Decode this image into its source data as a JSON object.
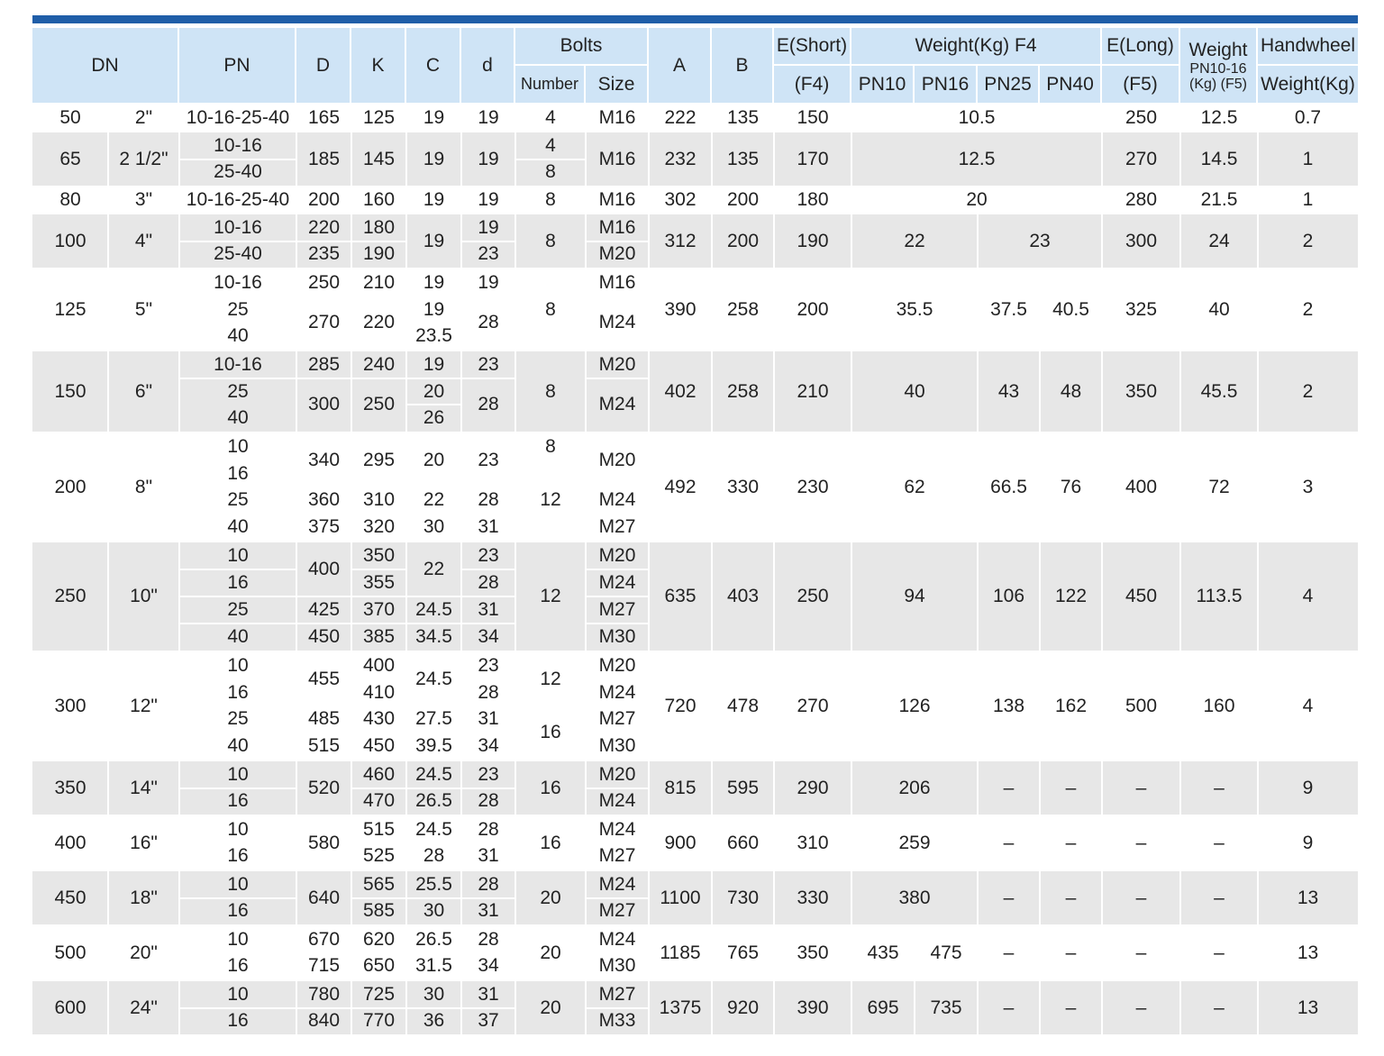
{
  "headers": {
    "dn": "DN",
    "pn": "PN",
    "d_upper": "D",
    "k": "K",
    "c": "C",
    "d_lower": "d",
    "bolts": "Bolts",
    "bolts_number": "Number",
    "bolts_size": "Size",
    "a": "A",
    "b": "B",
    "e_short": "E(Short)",
    "e_short_sub": "(F4)",
    "weight_f4": "Weight(Kg) F4",
    "pn10": "PN10",
    "pn16": "PN16",
    "pn25": "PN25",
    "pn40": "PN40",
    "e_long": "E(Long)",
    "e_long_sub": "(F5)",
    "weight_f5": "Weight",
    "weight_f5_sub1": "PN10-16",
    "weight_f5_sub2": "(Kg) (F5)",
    "handwheel": "Handwheel",
    "handwheel_sub": "Weight(Kg)"
  },
  "colors": {
    "header_bg": "#cfe4f6",
    "row_shade": "#e7e7e7",
    "top_bar": "#1f5ea8",
    "grid_line": "#ffffff"
  },
  "rows": [
    {
      "dn": "50",
      "inch": "2\"",
      "pn": [
        "10-16-25-40"
      ],
      "D": [
        "165"
      ],
      "K": [
        "125"
      ],
      "C": [
        "19"
      ],
      "d": [
        "19"
      ],
      "bolt_number": [
        "4"
      ],
      "bolt_size": [
        "M16"
      ],
      "A": "222",
      "B": "135",
      "E_short": "150",
      "w_pn10": "10.5",
      "w_pn16": "",
      "w_pn25": "",
      "w_pn40": "",
      "E_long": "250",
      "weight_f5": "12.5",
      "handwheel": "0.7"
    },
    {
      "dn": "65",
      "inch": "2 1/2\"",
      "pn": [
        "10-16",
        "25-40"
      ],
      "D": [
        "185"
      ],
      "K": [
        "145"
      ],
      "C": [
        "19"
      ],
      "d": [
        "19"
      ],
      "bolt_number": [
        "4",
        "8"
      ],
      "bolt_size": [
        "M16"
      ],
      "A": "232",
      "B": "135",
      "E_short": "170",
      "w_pn10": "12.5",
      "w_pn16": "",
      "w_pn25": "",
      "w_pn40": "",
      "E_long": "270",
      "weight_f5": "14.5",
      "handwheel": "1"
    },
    {
      "dn": "80",
      "inch": "3\"",
      "pn": [
        "10-16-25-40"
      ],
      "D": [
        "200"
      ],
      "K": [
        "160"
      ],
      "C": [
        "19"
      ],
      "d": [
        "19"
      ],
      "bolt_number": [
        "8"
      ],
      "bolt_size": [
        "M16"
      ],
      "A": "302",
      "B": "200",
      "E_short": "180",
      "w_pn10": "20",
      "w_pn16": "",
      "w_pn25": "",
      "w_pn40": "",
      "E_long": "280",
      "weight_f5": "21.5",
      "handwheel": "1"
    },
    {
      "dn": "100",
      "inch": "4\"",
      "pn": [
        "10-16",
        "25-40"
      ],
      "D": [
        "220",
        "235"
      ],
      "K": [
        "180",
        "190"
      ],
      "C": [
        "19"
      ],
      "d": [
        "19",
        "23"
      ],
      "bolt_number": [
        "8"
      ],
      "bolt_size": [
        "M16",
        "M20"
      ],
      "A": "312",
      "B": "200",
      "E_short": "190",
      "w_pn10": "22",
      "w_pn16": "",
      "w_pn25": "23",
      "w_pn40": "",
      "E_long": "300",
      "weight_f5": "24",
      "handwheel": "2"
    },
    {
      "dn": "125",
      "inch": "5\"",
      "pn": [
        "10-16",
        "25",
        "40"
      ],
      "D": [
        "250",
        "270"
      ],
      "K": [
        "210",
        "220"
      ],
      "C": [
        "19",
        "19",
        "23.5"
      ],
      "d": [
        "19",
        "28"
      ],
      "bolt_number": [
        "8"
      ],
      "bolt_size": [
        "M16",
        "M24"
      ],
      "A": "390",
      "B": "258",
      "E_short": "200",
      "w_pn10": "35.5",
      "w_pn16": "",
      "w_pn25": "37.5",
      "w_pn40": "40.5",
      "E_long": "325",
      "weight_f5": "40",
      "handwheel": "2"
    },
    {
      "dn": "150",
      "inch": "6\"",
      "pn": [
        "10-16",
        "25",
        "40"
      ],
      "D": [
        "285",
        "300"
      ],
      "K": [
        "240",
        "250"
      ],
      "C": [
        "19",
        "20",
        "26"
      ],
      "d": [
        "23",
        "28"
      ],
      "bolt_number": [
        "8"
      ],
      "bolt_size": [
        "M20",
        "M24"
      ],
      "A": "402",
      "B": "258",
      "E_short": "210",
      "w_pn10": "40",
      "w_pn16": "",
      "w_pn25": "43",
      "w_pn40": "48",
      "E_long": "350",
      "weight_f5": "45.5",
      "handwheel": "2"
    },
    {
      "dn": "200",
      "inch": "8\"",
      "pn": [
        "10",
        "16",
        "25",
        "40"
      ],
      "D": [
        "340",
        "360",
        "375"
      ],
      "K": [
        "295",
        "310",
        "320"
      ],
      "C": [
        "20",
        "22",
        "30"
      ],
      "d": [
        "23",
        "28",
        "31"
      ],
      "bolt_number": [
        "8",
        "12"
      ],
      "bolt_size": [
        "M20",
        "M24",
        "M27"
      ],
      "A": "492",
      "B": "330",
      "E_short": "230",
      "w_pn10": "62",
      "w_pn16": "",
      "w_pn25": "66.5",
      "w_pn40": "76",
      "E_long": "400",
      "weight_f5": "72",
      "handwheel": "3"
    },
    {
      "dn": "250",
      "inch": "10\"",
      "pn": [
        "10",
        "16",
        "25",
        "40"
      ],
      "D": [
        "400",
        "425",
        "450"
      ],
      "K": [
        "350",
        "355",
        "370",
        "385"
      ],
      "C": [
        "22",
        "24.5",
        "34.5"
      ],
      "d": [
        "23",
        "28",
        "31",
        "34"
      ],
      "bolt_number": [
        "12"
      ],
      "bolt_size": [
        "M20",
        "M24",
        "M27",
        "M30"
      ],
      "A": "635",
      "B": "403",
      "E_short": "250",
      "w_pn10": "94",
      "w_pn16": "",
      "w_pn25": "106",
      "w_pn40": "122",
      "E_long": "450",
      "weight_f5": "113.5",
      "handwheel": "4"
    },
    {
      "dn": "300",
      "inch": "12\"",
      "pn": [
        "10",
        "16",
        "25",
        "40"
      ],
      "D": [
        "455",
        "485",
        "515"
      ],
      "K": [
        "400",
        "410",
        "430",
        "450"
      ],
      "C": [
        "24.5",
        "27.5",
        "39.5"
      ],
      "d": [
        "23",
        "28",
        "31",
        "34"
      ],
      "bolt_number": [
        "12",
        "16"
      ],
      "bolt_size": [
        "M20",
        "M24",
        "M27",
        "M30"
      ],
      "A": "720",
      "B": "478",
      "E_short": "270",
      "w_pn10": "126",
      "w_pn16": "",
      "w_pn25": "138",
      "w_pn40": "162",
      "E_long": "500",
      "weight_f5": "160",
      "handwheel": "4"
    },
    {
      "dn": "350",
      "inch": "14\"",
      "pn": [
        "10",
        "16"
      ],
      "D": [
        "520"
      ],
      "K": [
        "460",
        "470"
      ],
      "C": [
        "24.5",
        "26.5"
      ],
      "d": [
        "23",
        "28"
      ],
      "bolt_number": [
        "16"
      ],
      "bolt_size": [
        "M20",
        "M24"
      ],
      "A": "815",
      "B": "595",
      "E_short": "290",
      "w_pn10": "206",
      "w_pn16": "",
      "w_pn25": "–",
      "w_pn40": "–",
      "E_long": "–",
      "weight_f5": "–",
      "handwheel": "9"
    },
    {
      "dn": "400",
      "inch": "16\"",
      "pn": [
        "10",
        "16"
      ],
      "D": [
        "580"
      ],
      "K": [
        "515",
        "525"
      ],
      "C": [
        "24.5",
        "28"
      ],
      "d": [
        "28",
        "31"
      ],
      "bolt_number": [
        "16"
      ],
      "bolt_size": [
        "M24",
        "M27"
      ],
      "A": "900",
      "B": "660",
      "E_short": "310",
      "w_pn10": "259",
      "w_pn16": "",
      "w_pn25": "–",
      "w_pn40": "–",
      "E_long": "–",
      "weight_f5": "–",
      "handwheel": "9"
    },
    {
      "dn": "450",
      "inch": "18\"",
      "pn": [
        "10",
        "16"
      ],
      "D": [
        "640"
      ],
      "K": [
        "565",
        "585"
      ],
      "C": [
        "25.5",
        "30"
      ],
      "d": [
        "28",
        "31"
      ],
      "bolt_number": [
        "20"
      ],
      "bolt_size": [
        "M24",
        "M27"
      ],
      "A": "1100",
      "B": "730",
      "E_short": "330",
      "w_pn10": "380",
      "w_pn16": "",
      "w_pn25": "–",
      "w_pn40": "–",
      "E_long": "–",
      "weight_f5": "–",
      "handwheel": "13"
    },
    {
      "dn": "500",
      "inch": "20\"",
      "pn": [
        "10",
        "16"
      ],
      "D": [
        "670",
        "715"
      ],
      "K": [
        "620",
        "650"
      ],
      "C": [
        "26.5",
        "31.5"
      ],
      "d": [
        "28",
        "34"
      ],
      "bolt_number": [
        "20"
      ],
      "bolt_size": [
        "M24",
        "M30"
      ],
      "A": "1185",
      "B": "765",
      "E_short": "350",
      "w_pn10": "435",
      "w_pn16": "475",
      "w_pn25": "–",
      "w_pn40": "–",
      "E_long": "–",
      "weight_f5": "–",
      "handwheel": "13"
    },
    {
      "dn": "600",
      "inch": "24\"",
      "pn": [
        "10",
        "16"
      ],
      "D": [
        "780",
        "840"
      ],
      "K": [
        "725",
        "770"
      ],
      "C": [
        "30",
        "36"
      ],
      "d": [
        "31",
        "37"
      ],
      "bolt_number": [
        "20"
      ],
      "bolt_size": [
        "M27",
        "M33"
      ],
      "A": "1375",
      "B": "920",
      "E_short": "390",
      "w_pn10": "695",
      "w_pn16": "735",
      "w_pn25": "–",
      "w_pn40": "–",
      "E_long": "–",
      "weight_f5": "–",
      "handwheel": "13"
    }
  ]
}
